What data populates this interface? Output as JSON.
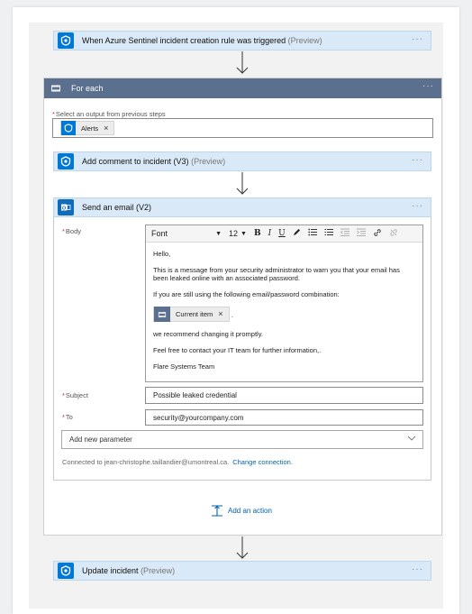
{
  "trigger": {
    "title": "When Azure Sentinel incident creation rule was triggered",
    "preview": "(Preview)",
    "icon": "azure-sentinel-icon"
  },
  "for_each": {
    "title": "For each",
    "select_label": "Select an output from previous steps",
    "token": "Alerts"
  },
  "add_comment": {
    "title": "Add comment to incident (V3)",
    "preview": "(Preview)"
  },
  "send_email": {
    "title": "Send an email (V2)",
    "body_label": "Body",
    "toolbar": {
      "font": "Font",
      "size": "12"
    },
    "body": {
      "line1": "Hello,",
      "line2": "This is a message from your security administrator to warn you that your email has been leaked online with an associated password.",
      "line3": "If you are still using the following email/password combination:",
      "token": "Current item",
      "token_suffix": "·",
      "line4": "we recommend changing it promptly.",
      "line5": "Feel free to contact your IT team for further information,.",
      "line6": "Flare Systems Team"
    },
    "subject_label": "Subject",
    "subject_value": "Possible leaked credential",
    "to_label": "To",
    "to_value": "security@yourcompany.com",
    "add_param": "Add new parameter",
    "connected_text": "Connected to jean-christophe.taillandier@umontreal.ca.",
    "change_connection": "Change connection."
  },
  "add_action": "Add an action",
  "update": {
    "title": "Update incident",
    "preview": "(Preview)"
  },
  "more": "···",
  "colors": {
    "header_bg": "#d9e9f7",
    "foreach_bg": "#5b6f8f",
    "sentinel_blue": "#0078d4",
    "outlook_blue": "#0f6cbd",
    "link": "#0063b1",
    "required": "#c4314b"
  }
}
